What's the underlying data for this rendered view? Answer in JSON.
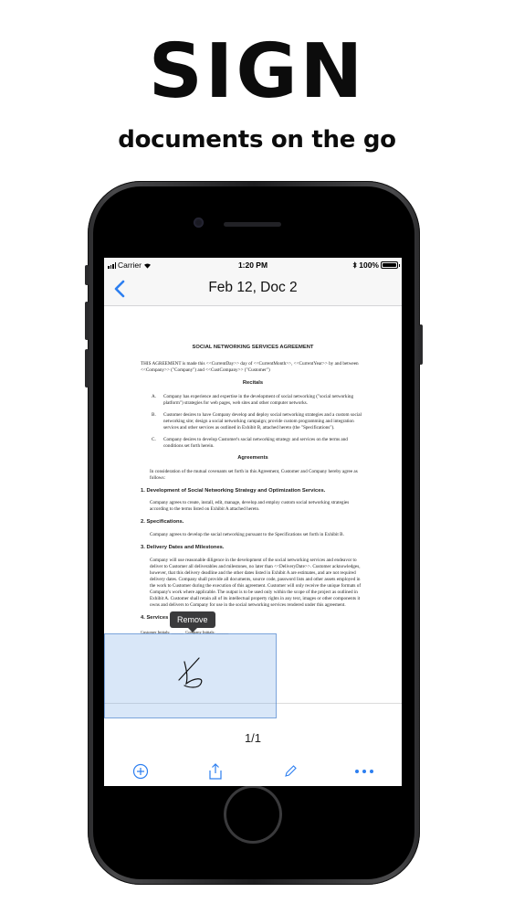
{
  "hero": {
    "title": "SIGN",
    "subtitle": "documents on the go"
  },
  "statusbar": {
    "carrier": "Carrier",
    "time": "1:20 PM",
    "battery": "100%"
  },
  "navbar": {
    "title": "Feb 12, Doc 2",
    "back_icon": "chevron-left-icon"
  },
  "document": {
    "title": "SOCIAL NETWORKING SERVICES AGREEMENT",
    "intro": "THIS AGREEMENT is made this <<CurrentDay>> day of <<CurrentMonth>>, <<CurrentYear>> by and between <<Company>> (\"Company\") and <<CustCompany>> (\"Customer\")",
    "recitals_heading": "Recitals",
    "recitals": [
      {
        "letter": "A.",
        "text": "Company has experience and expertise in the development of social networking (\"social networking platform\") strategies for web pages, web sites and other computer networks."
      },
      {
        "letter": "B.",
        "text": "Customer desires to have Company develop and deploy social networking strategies and a custom social networking site; design a social networking campaign; provide custom programming and integration services and other services as outlined in Exhibit B, attached hereto (the \"Specifications\")."
      },
      {
        "letter": "C.",
        "text": "Company desires to develop Customer's social networking strategy and services on the terms and conditions set forth herein."
      }
    ],
    "agreements_heading": "Agreements",
    "agreements_intro": "In consideration of the mutual covenants set forth in this Agreement, Customer and Company hereby agree as follows:",
    "section1_heading": "1. Development of Social Networking Strategy and Optimization Services.",
    "section1_text": "Company agrees to create, install, edit, manage, develop and employ custom social networking strategies according to the terms listed on Exhibit A attached hereto.",
    "section2_heading": "2. Specifications.",
    "section2_text": "Company agrees to develop the social networking pursuant to the Specifications set forth in Exhibit B.",
    "section3_heading": "3. Delivery Dates and Milestones.",
    "section3_text": "Company will use reasonable diligence in the development of the social networking services and endeavor to deliver to Customer all deliverables and milestones, no later than <<DeliveryDate>>. Customer acknowledges, however, that this delivery deadline and the other dates listed in Exhibit A are estimates, and are not required delivery dates. Company shall provide all documents, source code, password lists and other assets employed in the work to Customer during the execution of this agreement. Customer will only receive the unique formats of Company's work where applicable. The output is to be used only within the scope of the project as outlined in Exhibit A. Customer shall retain all of its intellectual property rights in any text, images or other components it owns and delivers to Company for use in the social networking services rendered under this agreement.",
    "section4_heading": "4. Services Provided.",
    "initials_customer": "Customer Initials: ______",
    "initials_company": "Company Initials: ______"
  },
  "remove_label": "Remove",
  "page_indicator": "1/1",
  "toolbar": {
    "add_icon": "plus-circle-icon",
    "share_icon": "share-icon",
    "edit_icon": "pen-icon",
    "more_icon": "more-icon"
  },
  "colors": {
    "accent": "#2d7ff0",
    "selection": "#8ab4e6"
  }
}
